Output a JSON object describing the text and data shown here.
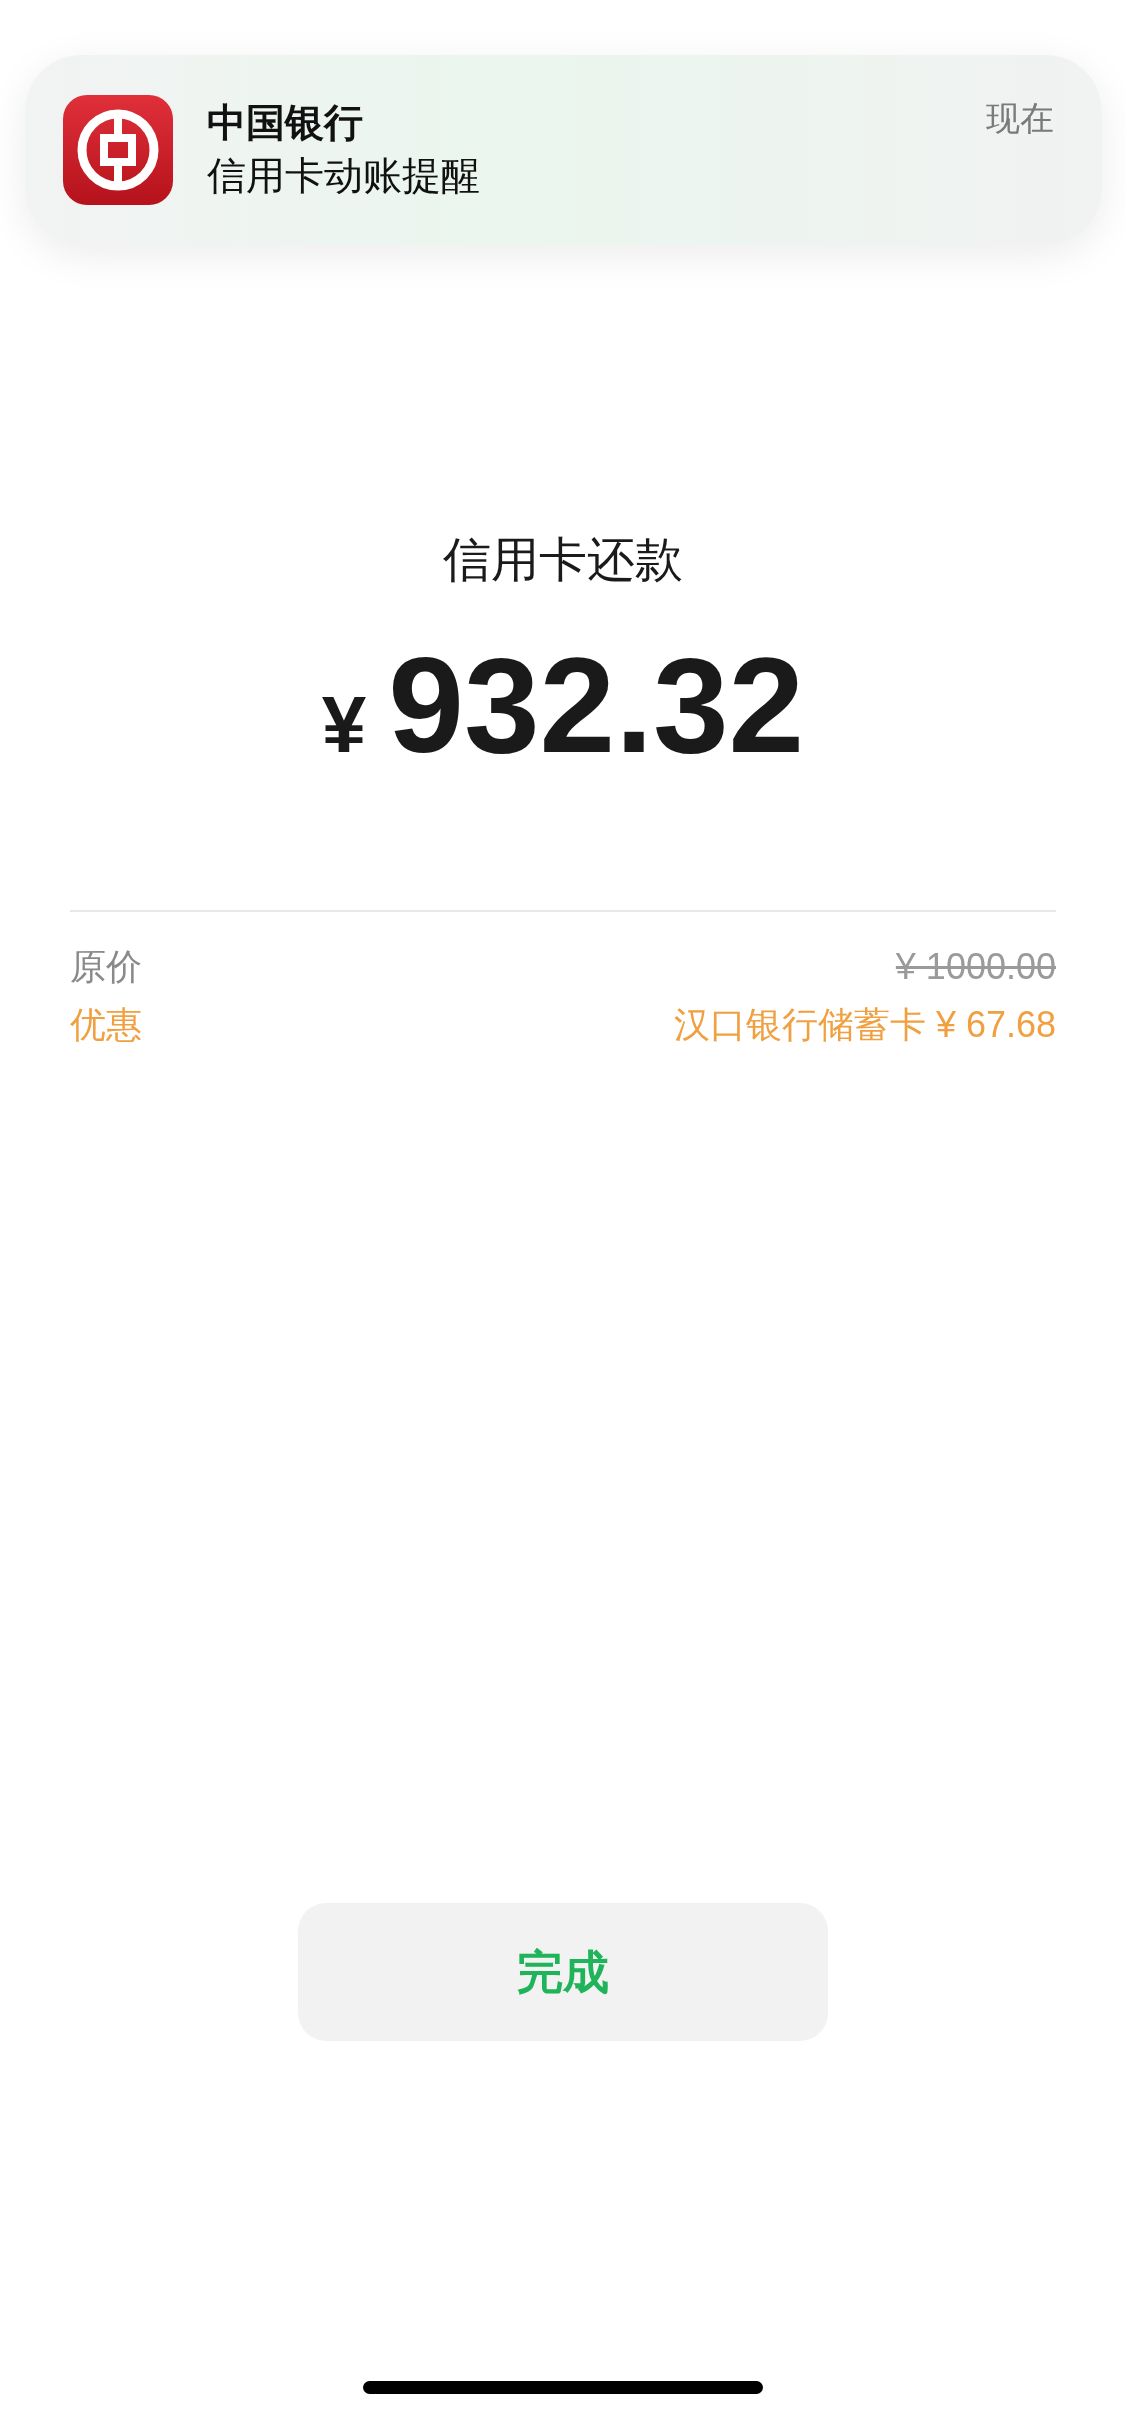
{
  "notification": {
    "app": "中国银行",
    "message": "信用卡动账提醒",
    "time": "现在"
  },
  "payment": {
    "title": "信用卡还款",
    "currency": "¥",
    "amount": "932.32"
  },
  "details": [
    {
      "kind": "original",
      "label": "原价",
      "value": "¥ 1000.00"
    },
    {
      "kind": "discount",
      "label": "优惠",
      "value": "汉口银行储蓄卡 ¥ 67.68"
    }
  ],
  "done_button": "完成"
}
